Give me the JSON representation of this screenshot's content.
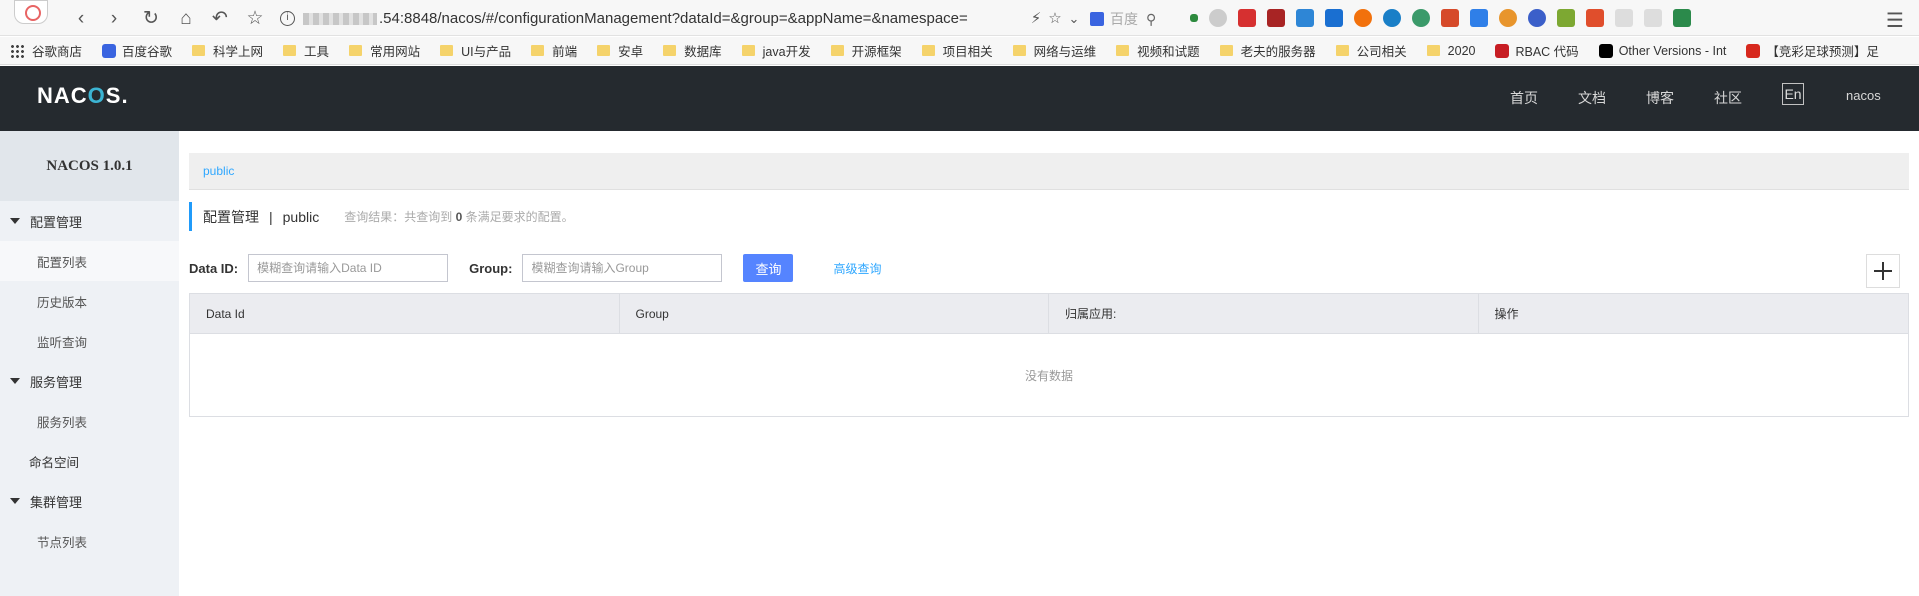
{
  "browser": {
    "url_prefix": "",
    "url_suffix": ".54:8848/nacos/#/configurationManagement?dataId=&group=&appName=&namespace=",
    "search_engine": "百度",
    "bookmarks": [
      {
        "label": "谷歌商店",
        "icon": "apps-icon"
      },
      {
        "label": "百度谷歌",
        "icon": "baidu-icon"
      },
      {
        "label": "科学上网",
        "icon": "folder-icon"
      },
      {
        "label": "工具",
        "icon": "folder-icon"
      },
      {
        "label": "常用网站",
        "icon": "folder-icon"
      },
      {
        "label": "UI与产品",
        "icon": "folder-icon"
      },
      {
        "label": "前端",
        "icon": "folder-icon"
      },
      {
        "label": "安卓",
        "icon": "folder-icon"
      },
      {
        "label": "数据库",
        "icon": "folder-icon"
      },
      {
        "label": "java开发",
        "icon": "folder-icon"
      },
      {
        "label": "开源框架",
        "icon": "folder-icon"
      },
      {
        "label": "项目相关",
        "icon": "folder-icon"
      },
      {
        "label": "网络与运维",
        "icon": "folder-icon"
      },
      {
        "label": "视频和试题",
        "icon": "folder-icon"
      },
      {
        "label": "老夫的服务器",
        "icon": "folder-icon"
      },
      {
        "label": "公司相关",
        "icon": "folder-icon"
      },
      {
        "label": "2020",
        "icon": "folder-icon"
      },
      {
        "label": "RBAC 代码",
        "icon": "gitee-icon"
      },
      {
        "label": "Other Versions - Int",
        "icon": "jb-icon"
      },
      {
        "label": "【竞彩足球预测】足",
        "icon": "num5-icon"
      }
    ]
  },
  "header": {
    "logo": "NACOS.",
    "nav": [
      "首页",
      "文档",
      "博客",
      "社区"
    ],
    "lang": "En",
    "user": "nacos"
  },
  "sidebar": {
    "title": "NACOS 1.0.1",
    "groups": [
      {
        "label": "配置管理",
        "items": [
          "配置列表",
          "历史版本",
          "监听查询"
        ]
      },
      {
        "label": "服务管理",
        "items": [
          "服务列表"
        ]
      }
    ],
    "namespace": "命名空间",
    "cluster": {
      "label": "集群管理",
      "items": [
        "节点列表"
      ]
    }
  },
  "main": {
    "namespace_tab": "public",
    "title": "配置管理",
    "title_ns": "public",
    "result_prefix": "查询结果：共查询到",
    "result_count": "0",
    "result_suffix": "条满足要求的配置。",
    "dataid_label": "Data ID:",
    "dataid_placeholder": "模糊查询请输入Data ID",
    "group_label": "Group:",
    "group_placeholder": "模糊查询请输入Group",
    "query_button": "查询",
    "advanced_query": "高级查询",
    "table": {
      "columns": [
        "Data Id",
        "Group",
        "归属应用:",
        "操作"
      ],
      "empty": "没有数据"
    }
  },
  "colors": {
    "header_bg": "#252a2f",
    "primary": "#5584ff",
    "link": "#2fa7ff"
  }
}
